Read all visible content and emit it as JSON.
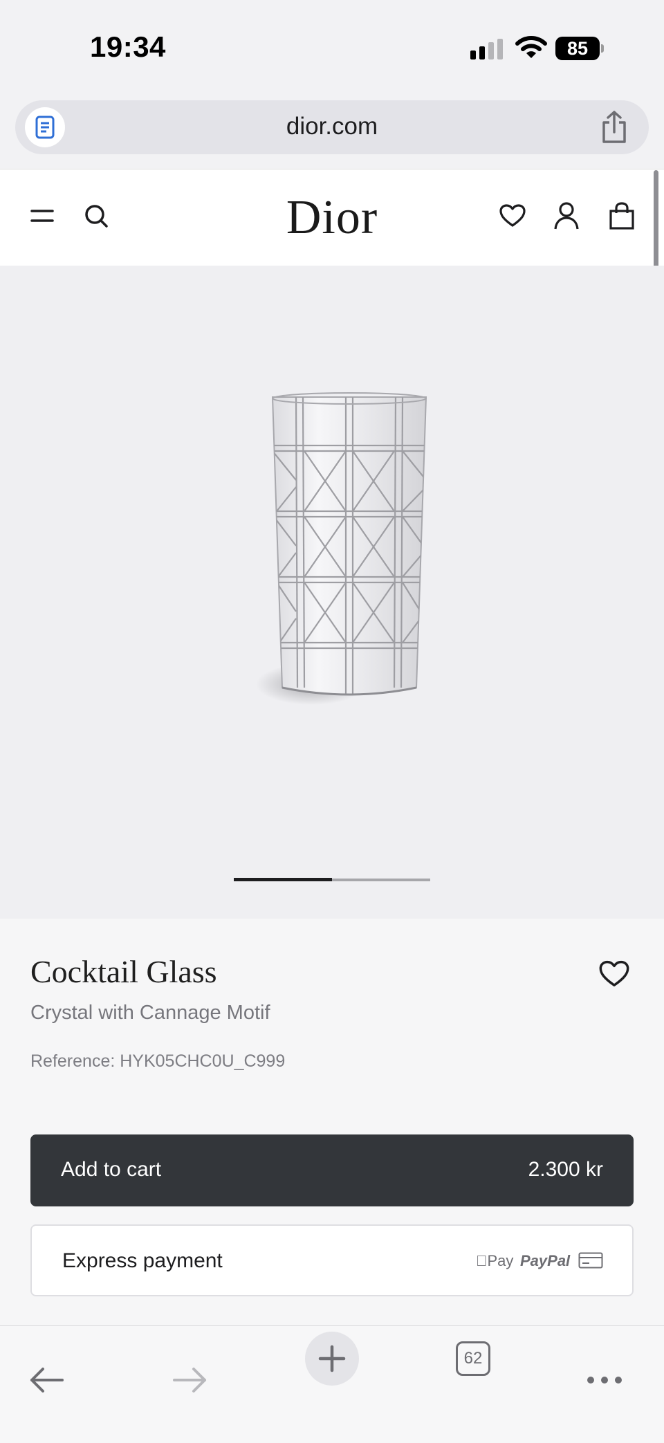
{
  "status_bar": {
    "time": "19:34",
    "battery": "85",
    "icons": [
      "signal-icon",
      "wifi-icon",
      "battery-icon"
    ]
  },
  "browser": {
    "url": "dior.com",
    "icons": [
      "reader-icon",
      "share-icon"
    ]
  },
  "site_header": {
    "logo": "Dior",
    "icons": [
      "menu-icon",
      "search-icon",
      "wishlist-heart-icon",
      "account-icon",
      "shopping-bag-icon"
    ]
  },
  "product": {
    "title": "Cocktail Glass",
    "subtitle": "Crystal with Cannage Motif",
    "reference": "Reference: HYK05CHC0U_C999",
    "carousel": {
      "current": 1,
      "total": 2
    }
  },
  "actions": {
    "add_to_cart": "Add to cart",
    "price": "2.300 kr",
    "express_payment": "Express payment",
    "apple_pay": "Pay",
    "paypal": "PayPal"
  },
  "toolbar": {
    "tab_count": "62",
    "icons": [
      "back-arrow-icon",
      "forward-arrow-icon",
      "plus-icon",
      "tabs-icon",
      "more-icon"
    ]
  },
  "colors": {
    "button_dark": "#33363a",
    "hero_background": "#efeff2",
    "reader_icon_blue": "#2f6fd6"
  }
}
